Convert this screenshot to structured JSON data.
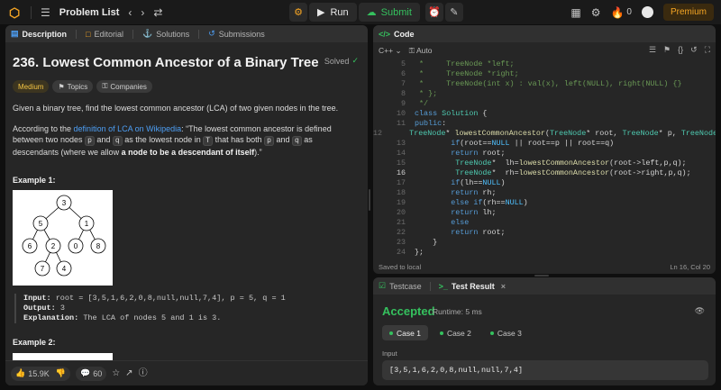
{
  "topbar": {
    "problem_list": "Problem List",
    "run": "Run",
    "submit": "Submit",
    "streak": "0",
    "premium": "Premium"
  },
  "left_tabs": {
    "description": "Description",
    "editorial": "Editorial",
    "solutions": "Solutions",
    "submissions": "Submissions"
  },
  "problem": {
    "title": "236. Lowest Common Ancestor of a Binary Tree",
    "status": "Solved",
    "difficulty": "Medium",
    "topics": "Topics",
    "companies": "Companies",
    "para1": "Given a binary tree, find the lowest common ancestor (LCA) of two given nodes in the tree.",
    "para2_a": "According to the ",
    "para2_link": "definition of LCA on Wikipedia",
    "para2_b": ": “The lowest common ancestor is defined between two nodes ",
    "p_code": "p",
    "and": " and ",
    "q_code": "q",
    "para2_c": " as the lowest node in ",
    "T_code": "T",
    "para2_d": " that has both ",
    "para2_e": " as descendants (where we allow ",
    "para2_bold": "a node to be a descendant of itself",
    "para2_end": ").”",
    "example1_heading": "Example 1:",
    "example1_input_label": "Input:",
    "example1_input": " root = [3,5,1,6,2,0,8,null,null,7,4], p = 5, q = 1",
    "example1_output_label": "Output:",
    "example1_output": " 3",
    "example1_expl_label": "Explanation:",
    "example1_expl": " The LCA of nodes 5 and 1 is 3.",
    "example2_heading": "Example 2:",
    "tree_nodes": [
      "3",
      "5",
      "1",
      "6",
      "2",
      "0",
      "8",
      "7",
      "4"
    ]
  },
  "left_footer": {
    "likes": "15.9K",
    "comments": "60"
  },
  "code_panel": {
    "title": "Code",
    "language": "C++",
    "mode": "Auto",
    "saved": "Saved to local",
    "cursor": "Ln 16, Col 20",
    "lines": [
      {
        "n": "5",
        "t": " *     TreeNode *left;"
      },
      {
        "n": "6",
        "t": " *     TreeNode *right;"
      },
      {
        "n": "7",
        "t": " *     TreeNode(int x) : val(x), left(NULL), right(NULL) {}"
      },
      {
        "n": "8",
        "t": " * };"
      },
      {
        "n": "9",
        "t": " */"
      },
      {
        "n": "10",
        "t": "class Solution {"
      },
      {
        "n": "11",
        "t": "public:"
      },
      {
        "n": "12",
        "t": "    TreeNode* lowestCommonAncestor(TreeNode* root, TreeNode* p, TreeNode* q) {"
      },
      {
        "n": "13",
        "t": "        if(root==NULL || root==p || root==q)"
      },
      {
        "n": "14",
        "t": "        return root;"
      },
      {
        "n": "15",
        "t": "         TreeNode*  lh=lowestCommonAncestor(root->left,p,q);"
      },
      {
        "n": "16",
        "t": "         TreeNode*  rh=lowestCommonAncestor(root->right,p,q);"
      },
      {
        "n": "17",
        "t": "        if(lh==NULL)"
      },
      {
        "n": "18",
        "t": "        return rh;"
      },
      {
        "n": "19",
        "t": "        else if(rh==NULL)"
      },
      {
        "n": "20",
        "t": "        return lh;"
      },
      {
        "n": "21",
        "t": "        else"
      },
      {
        "n": "22",
        "t": "        return root;"
      },
      {
        "n": "23",
        "t": "    }"
      },
      {
        "n": "24",
        "t": "};"
      }
    ]
  },
  "result_panel": {
    "testcase_tab": "Testcase",
    "result_tab": "Test Result",
    "verdict": "Accepted",
    "runtime": "Runtime: 5 ms",
    "cases": [
      "Case 1",
      "Case 2",
      "Case 3"
    ],
    "input_label": "Input",
    "input_value": "[3,5,1,6,2,0,8,null,null,7,4]"
  },
  "colors": {
    "accent_green": "#35c15e",
    "premium_orange": "#f5a524",
    "link_blue": "#4d9ff5"
  }
}
